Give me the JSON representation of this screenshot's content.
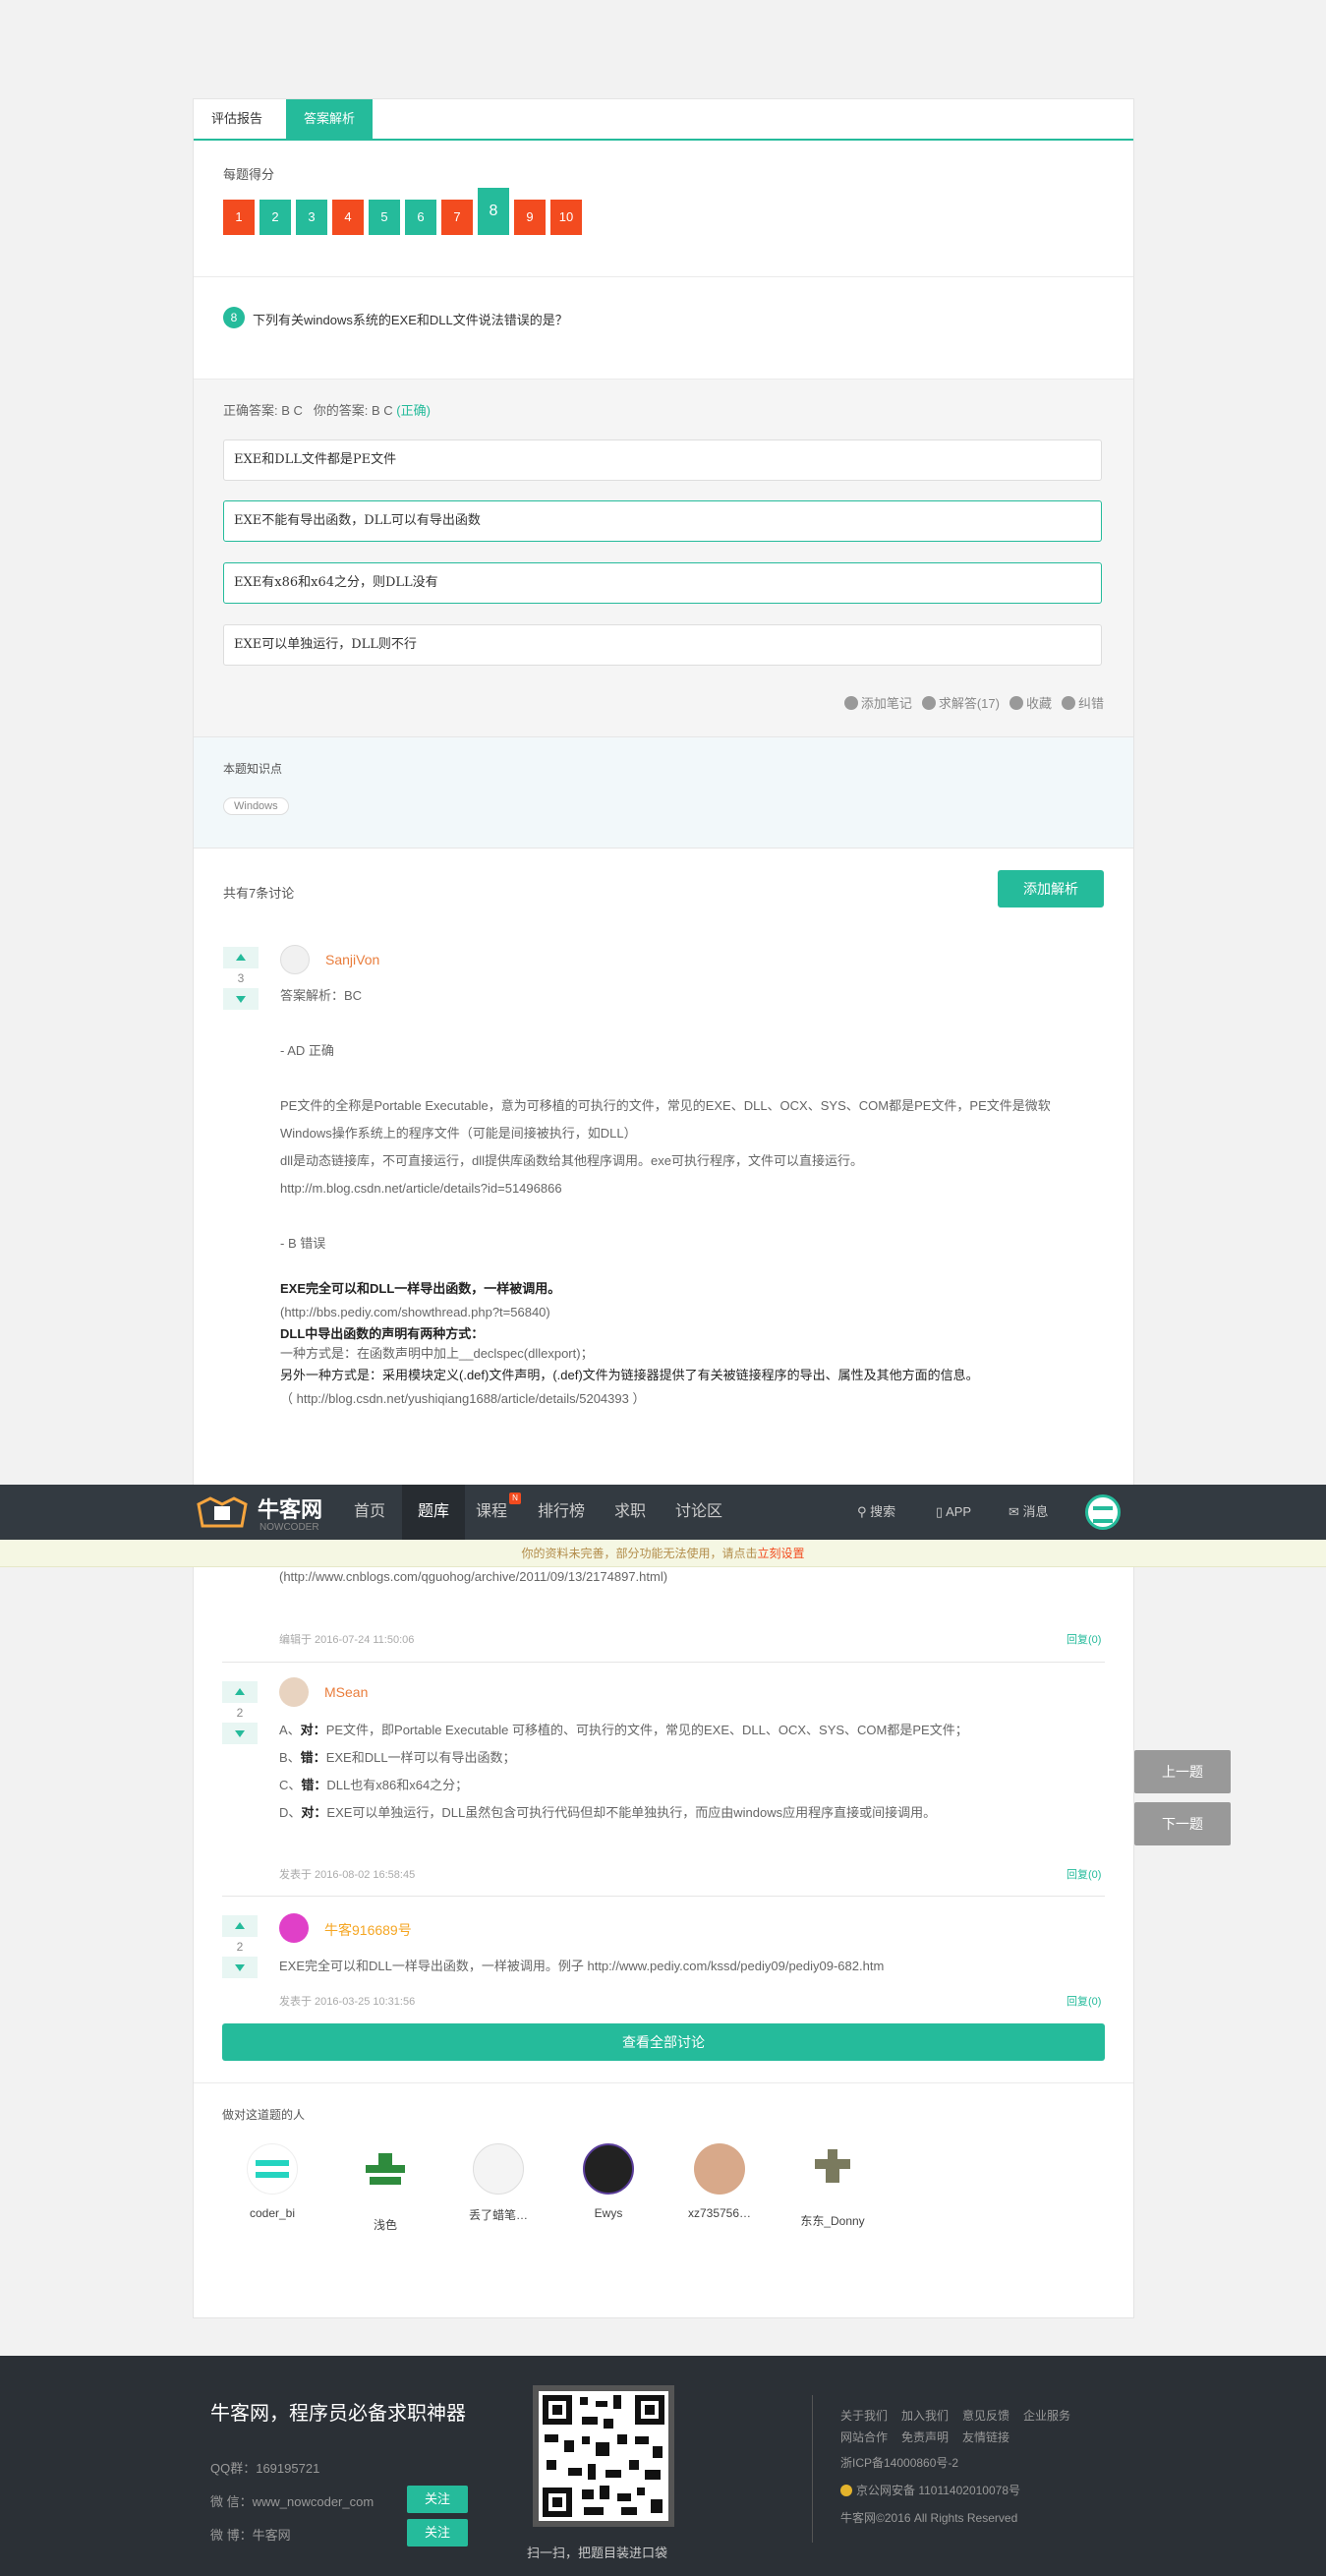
{
  "tabs": [
    "评估报告",
    "答案解析"
  ],
  "scores": {
    "label": "每题得分",
    "items": [
      {
        "n": "1",
        "status": "wrong"
      },
      {
        "n": "2",
        "status": "right"
      },
      {
        "n": "3",
        "status": "right"
      },
      {
        "n": "4",
        "status": "wrong"
      },
      {
        "n": "5",
        "status": "right"
      },
      {
        "n": "6",
        "status": "right"
      },
      {
        "n": "7",
        "status": "wrong"
      },
      {
        "n": "8",
        "status": "current"
      },
      {
        "n": "9",
        "status": "wrong"
      },
      {
        "n": "10",
        "status": "wrong"
      }
    ]
  },
  "question": {
    "num": "8",
    "text": "下列有关windows系统的EXE和DLL文件说法错误的是？"
  },
  "answer": {
    "correct_label": "正确答案: B C",
    "your_label": "你的答案: B C",
    "result": "(正确)",
    "options": [
      "EXE和DLL文件都是PE文件",
      "EXE不能有导出函数，DLL可以有导出函数",
      "EXE有x86和x64之分，则DLL没有",
      "EXE可以单独运行，DLL则不行"
    ]
  },
  "tools": {
    "note": "添加笔记",
    "ask": "求解答(17)",
    "fav": "收藏",
    "report": "纠错"
  },
  "knowledge": {
    "label": "本题知识点",
    "tag": "Windows"
  },
  "discussion": {
    "count_label": "共有7条讨论",
    "add_button": "添加解析",
    "view_all": "查看全部讨论"
  },
  "comments": [
    {
      "votes": "3",
      "user": "SanjiVon",
      "lines": [
        "答案解析：BC",
        "",
        "- AD 正确",
        "",
        "PE文件的全称是Portable Executable，意为可移植的可执行的文件，常见的EXE、DLL、OCX、SYS、COM都是PE文件，PE文件是微软",
        "Windows操作系统上的程序文件（可能是间接被执行，如DLL）",
        "dll是动态链接库，不可直接运行，dll提供库函数给其他程序调用。exe可执行程序，文件可以直接运行。",
        "http://m.blog.csdn.net/article/details?id=51496866",
        "",
        "- B 错误",
        ""
      ],
      "bold1": "EXE完全可以和DLL一样导出函数，一样被调用。",
      "url1": "(http://bbs.pediy.com/showthread.php?t=56840)",
      "bold2": "DLL中导出函数的声明有两种方式：",
      "way1": "一种方式是：在函数声明中加上__declspec(dllexport)；",
      "way2": "另外一种方式是：采用模块定义(.def)文件声明，(.def)文件为链接器提供了有关被链接程序的导出、属性及其他方面的信息。",
      "url2": "（ http://blog.csdn.net/yushiqiang1688/article/details/5204393 ）",
      "url3": "(http://www.cnblogs.com/qguohog/archive/2011/09/13/2174897.html)",
      "time": "编辑于 2016-07-24 11:50:06",
      "reply": "回复(0)"
    },
    {
      "votes": "2",
      "user": "MSean",
      "items": [
        {
          "p": "A、",
          "b": "对：",
          "t": "PE文件，即Portable Executable 可移植的、可执行的文件，常见的EXE、DLL、OCX、SYS、COM都是PE文件；"
        },
        {
          "p": "B、",
          "b": "错：",
          "t": "EXE和DLL一样可以有导出函数；"
        },
        {
          "p": "C、",
          "b": "错：",
          "t": "DLL也有x86和x64之分；"
        },
        {
          "p": "D、",
          "b": "对：",
          "t": "EXE可以单独运行，DLL虽然包含可执行代码但却不能单独执行，而应由windows应用程序直接或间接调用。"
        }
      ],
      "time": "发表于 2016-08-02 16:58:45",
      "reply": "回复(0)"
    },
    {
      "votes": "2",
      "user": "牛客916689号",
      "text": "EXE完全可以和DLL一样导出函数，一样被调用。例子 http://www.pediy.com/kssd/pediy09/pediy09-682.htm",
      "time": "发表于 2016-03-25 10:31:56",
      "reply": "回复(0)"
    }
  ],
  "correct_people": {
    "label": "做对这道题的人",
    "people": [
      "coder_bi",
      "浅色",
      "丢了蜡笔…",
      "Ewys",
      "xz735756…",
      "东东_Donny"
    ]
  },
  "navbar": {
    "brand": "牛客网",
    "brand_sub": "NOWCODER",
    "items": [
      "首页",
      "题库",
      "课程",
      "排行榜",
      "求职",
      "讨论区"
    ],
    "badge": "N",
    "search": "搜索",
    "app": "APP",
    "msg": "消息"
  },
  "notice": {
    "text": "你的资料未完善，部分功能无法使用，请点击",
    "link": "立刻设置"
  },
  "side": {
    "prev": "上一题",
    "next": "下一题"
  },
  "footer": {
    "slogan": "牛客网，程序员必备求职神器",
    "qq": "QQ群：169195721",
    "wechat": "微 信：www_nowcoder_com",
    "weibo": "微 博：牛客网",
    "follow": "关注",
    "qr_caption": "扫一扫，把题目装进口袋",
    "links_row1": [
      "关于我们",
      "加入我们",
      "意见反馈",
      "企业服务"
    ],
    "links_row2": [
      "网站合作",
      "免责声明",
      "友情链接"
    ],
    "icp": "浙ICP备14000860号-2",
    "police": "京公网安备 11011402010078号",
    "copyright": "牛客网©2016 All Rights Reserved"
  },
  "colors": {
    "green": "#25bb9b",
    "red": "#f34b1f",
    "nav": "#333a41",
    "footer": "#2b3036"
  }
}
